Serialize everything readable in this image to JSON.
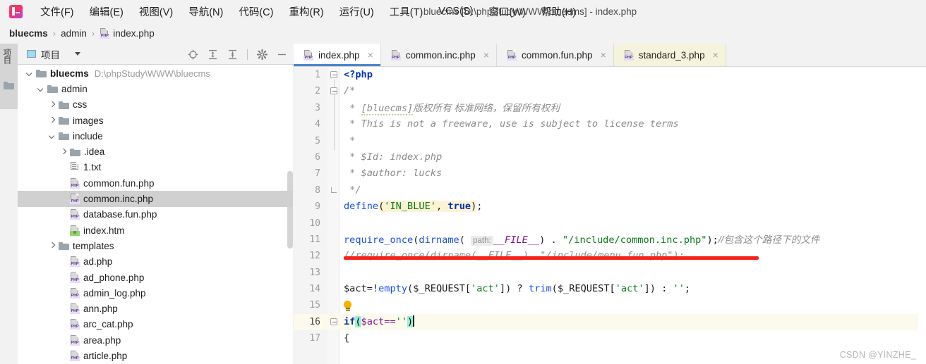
{
  "window": {
    "title": "bluecms [D:\\phpStudy\\WWW\\bluecms] - index.php"
  },
  "menu": {
    "items": [
      {
        "label": "文件(F)",
        "name": "menu-file"
      },
      {
        "label": "编辑(E)",
        "name": "menu-edit"
      },
      {
        "label": "视图(V)",
        "name": "menu-view"
      },
      {
        "label": "导航(N)",
        "name": "menu-navigate"
      },
      {
        "label": "代码(C)",
        "name": "menu-code"
      },
      {
        "label": "重构(R)",
        "name": "menu-refactor"
      },
      {
        "label": "运行(U)",
        "name": "menu-run"
      },
      {
        "label": "工具(T)",
        "name": "menu-tools"
      },
      {
        "label": "VCS(S)",
        "name": "menu-vcs"
      },
      {
        "label": "窗口(W)",
        "name": "menu-window"
      },
      {
        "label": "帮助(H)",
        "name": "menu-help"
      }
    ]
  },
  "breadcrumb": {
    "items": [
      "bluecms",
      "admin",
      "index.php"
    ],
    "separator": "›"
  },
  "toolstrip": {
    "project_label": "项目"
  },
  "project_panel": {
    "title": "项目",
    "tools": [
      {
        "name": "locate-target-icon",
        "title": "Select Opened File"
      },
      {
        "name": "expand-all-icon",
        "title": "Expand All"
      },
      {
        "name": "collapse-all-icon",
        "title": "Collapse All"
      },
      {
        "name": "gear-icon",
        "title": "Settings"
      },
      {
        "name": "minimize-icon",
        "title": "Hide"
      }
    ],
    "tree": [
      {
        "label": "bluecms",
        "sub": "D:\\phpStudy\\WWW\\bluecms",
        "indent": 0,
        "arrow": "down",
        "icon": "folder",
        "bold": true,
        "selected": false
      },
      {
        "label": "admin",
        "sub": "",
        "indent": 1,
        "arrow": "down",
        "icon": "folder",
        "bold": false,
        "selected": false
      },
      {
        "label": "css",
        "sub": "",
        "indent": 2,
        "arrow": "right",
        "icon": "folder",
        "bold": false,
        "selected": false
      },
      {
        "label": "images",
        "sub": "",
        "indent": 2,
        "arrow": "right",
        "icon": "folder",
        "bold": false,
        "selected": false
      },
      {
        "label": "include",
        "sub": "",
        "indent": 2,
        "arrow": "down",
        "icon": "folder",
        "bold": false,
        "selected": false
      },
      {
        "label": ".idea",
        "sub": "",
        "indent": 3,
        "arrow": "right",
        "icon": "folder",
        "bold": false,
        "selected": false
      },
      {
        "label": "1.txt",
        "sub": "",
        "indent": 3,
        "arrow": "none",
        "icon": "txt",
        "bold": false,
        "selected": false
      },
      {
        "label": "common.fun.php",
        "sub": "",
        "indent": 3,
        "arrow": "none",
        "icon": "php",
        "bold": false,
        "selected": false
      },
      {
        "label": "common.inc.php",
        "sub": "",
        "indent": 3,
        "arrow": "none",
        "icon": "php",
        "bold": false,
        "selected": true
      },
      {
        "label": "database.fun.php",
        "sub": "",
        "indent": 3,
        "arrow": "none",
        "icon": "php",
        "bold": false,
        "selected": false
      },
      {
        "label": "index.htm",
        "sub": "",
        "indent": 3,
        "arrow": "none",
        "icon": "html",
        "bold": false,
        "selected": false
      },
      {
        "label": "templates",
        "sub": "",
        "indent": 2,
        "arrow": "right",
        "icon": "folder",
        "bold": false,
        "selected": false
      },
      {
        "label": "ad.php",
        "sub": "",
        "indent": 3,
        "arrow": "none",
        "icon": "php",
        "bold": false,
        "selected": false
      },
      {
        "label": "ad_phone.php",
        "sub": "",
        "indent": 3,
        "arrow": "none",
        "icon": "php",
        "bold": false,
        "selected": false
      },
      {
        "label": "admin_log.php",
        "sub": "",
        "indent": 3,
        "arrow": "none",
        "icon": "php",
        "bold": false,
        "selected": false
      },
      {
        "label": "ann.php",
        "sub": "",
        "indent": 3,
        "arrow": "none",
        "icon": "php",
        "bold": false,
        "selected": false
      },
      {
        "label": "arc_cat.php",
        "sub": "",
        "indent": 3,
        "arrow": "none",
        "icon": "php",
        "bold": false,
        "selected": false
      },
      {
        "label": "area.php",
        "sub": "",
        "indent": 3,
        "arrow": "none",
        "icon": "php",
        "bold": false,
        "selected": false
      },
      {
        "label": "article.php",
        "sub": "",
        "indent": 3,
        "arrow": "none",
        "icon": "php",
        "bold": false,
        "selected": false
      }
    ]
  },
  "editor": {
    "tabs": [
      {
        "label": "index.php",
        "active": true,
        "tinted": false,
        "close": "×"
      },
      {
        "label": "common.inc.php",
        "active": false,
        "tinted": false,
        "close": "×"
      },
      {
        "label": "common.fun.php",
        "active": false,
        "tinted": false,
        "close": "×"
      },
      {
        "label": "standard_3.php",
        "active": false,
        "tinted": true,
        "close": "×"
      }
    ],
    "line_numbers": [
      "1",
      "2",
      "3",
      "4",
      "5",
      "6",
      "7",
      "8",
      "9",
      "10",
      "11",
      "12",
      "13",
      "14",
      "15",
      "16",
      "17"
    ],
    "code": {
      "l1": "<?php",
      "l2": "/*",
      "l3_star": " * ",
      "l3_bracket": "[bluecms]",
      "l3_text": "版权所有 标准网络，保留所有权利",
      "l4": " * This is not a freeware, use is subject to license terms",
      "l5": " *",
      "l6": " * $Id: index.php",
      "l7": " * $author: lucks",
      "l8": " */",
      "l9_kw": "define",
      "l9_rest": "('IN_BLUE', true);",
      "l9_str": "'IN_BLUE'",
      "l9_true": "true",
      "l10": "",
      "l11_fn1": "require_once",
      "l11_fn2": "dirname",
      "l11_hint": "path:",
      "l11_file": "__FILE__",
      "l11_str": "\"/include/common.inc.php\"",
      "l11_comment": "//包含这个路径下的文件",
      "l12": "//require_once(dirname(__FILE__). \"/include/menu.fun.php\");",
      "l13": "",
      "l14_a": "$act=!",
      "l14_empty": "empty",
      "l14_b": "($_REQUEST[",
      "l14_act1": "'act'",
      "l14_c": "]) ? ",
      "l14_trim": "trim",
      "l14_d": "($_REQUEST[",
      "l14_act2": "'act'",
      "l14_e": "]) : ",
      "l14_empty_str": "''",
      "l14_f": ";",
      "l15": "",
      "l16_if": "if",
      "l16_p1": "(",
      "l16_var": "$act==",
      "l16_str": "''",
      "l16_p2": ")",
      "l17": "{"
    }
  },
  "watermark": "CSDN @YINZHE_",
  "colors": {
    "accent": "#4a86c8",
    "keyword": "#0033b3",
    "string": "#067d17",
    "comment": "#8c8c8c",
    "function": "#1750eb",
    "annotation_red": "#f5221c",
    "selection_gray": "#d0d0d0",
    "tinted_tab": "#f5f3dc"
  }
}
